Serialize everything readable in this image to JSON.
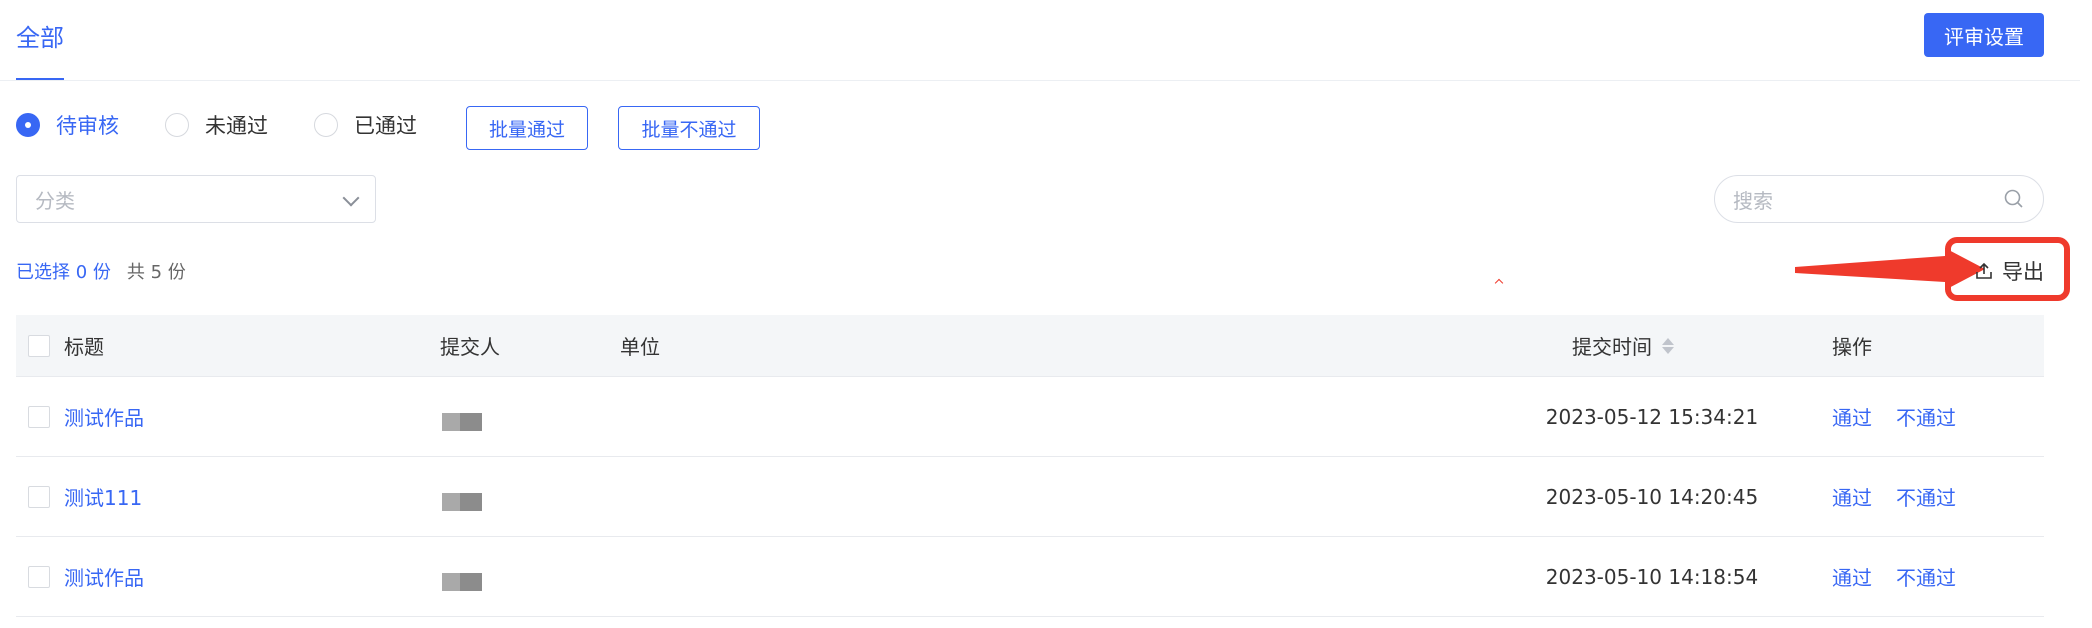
{
  "tabs": {
    "active": "全部"
  },
  "header": {
    "review_settings": "评审设置"
  },
  "filters": {
    "statuses": [
      "待审核",
      "未通过",
      "已通过"
    ],
    "selected_status": "待审核",
    "batch_pass": "批量通过",
    "batch_fail": "批量不通过",
    "category_placeholder": "分类",
    "search_placeholder": "搜索"
  },
  "selection": {
    "selected_text": "已选择 0 份",
    "total_text": "共 5 份"
  },
  "toolbar": {
    "export_label": "导出"
  },
  "table": {
    "headers": {
      "title": "标题",
      "submitter": "提交人",
      "unit": "单位",
      "time": "提交时间",
      "ops": "操作"
    },
    "rows": [
      {
        "title": "测试作品",
        "time": "2023-05-12 15:34:21",
        "pass": "通过",
        "fail": "不通过"
      },
      {
        "title": "测试111",
        "time": "2023-05-10 14:20:45",
        "pass": "通过",
        "fail": "不通过"
      },
      {
        "title": "测试作品",
        "time": "2023-05-10 14:18:54",
        "pass": "通过",
        "fail": "不通过"
      }
    ]
  },
  "colors": {
    "accent": "#3867f4",
    "annotation": "#ef3a2c"
  }
}
